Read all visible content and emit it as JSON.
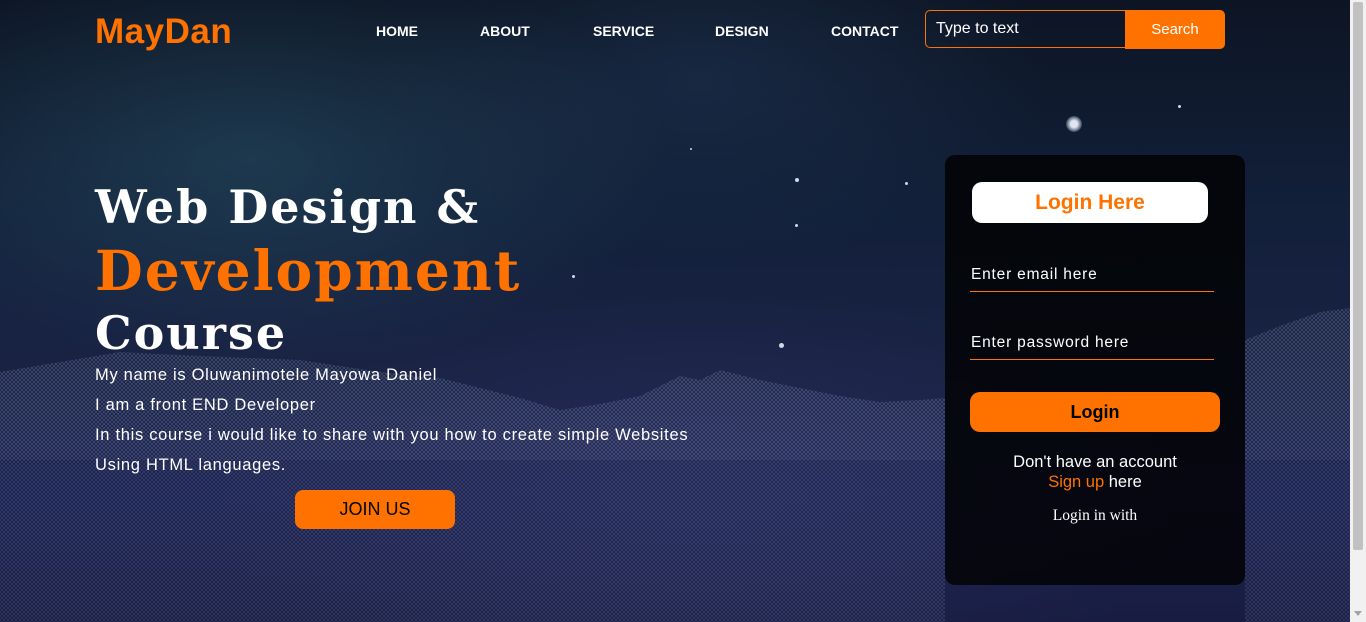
{
  "brand": {
    "logo": "MayDan"
  },
  "nav": {
    "items": [
      {
        "label": "HOME"
      },
      {
        "label": "ABOUT"
      },
      {
        "label": "SERVICE"
      },
      {
        "label": "DESIGN"
      },
      {
        "label": "CONTACT"
      }
    ]
  },
  "search": {
    "placeholder": "Type to text",
    "button_label": "Search"
  },
  "hero": {
    "line1": "Web Design &",
    "line2": "Development",
    "line3": "Course",
    "paragraphs": [
      "My name is Oluwanimotele Mayowa Daniel",
      "I am a front END Developer",
      "In this course i would like to share with you how to create simple Websites",
      "Using HTML languages."
    ],
    "join_label": "JOIN US"
  },
  "login": {
    "title": "Login Here",
    "email_placeholder": "Enter email here",
    "password_placeholder": "Enter password here",
    "button_label": "Login",
    "no_account": "Don't have an account",
    "signup_link": "Sign up",
    "signup_suffix": " here",
    "login_with": "Login in with"
  },
  "colors": {
    "accent": "#ff7200",
    "text": "#ffffff"
  }
}
